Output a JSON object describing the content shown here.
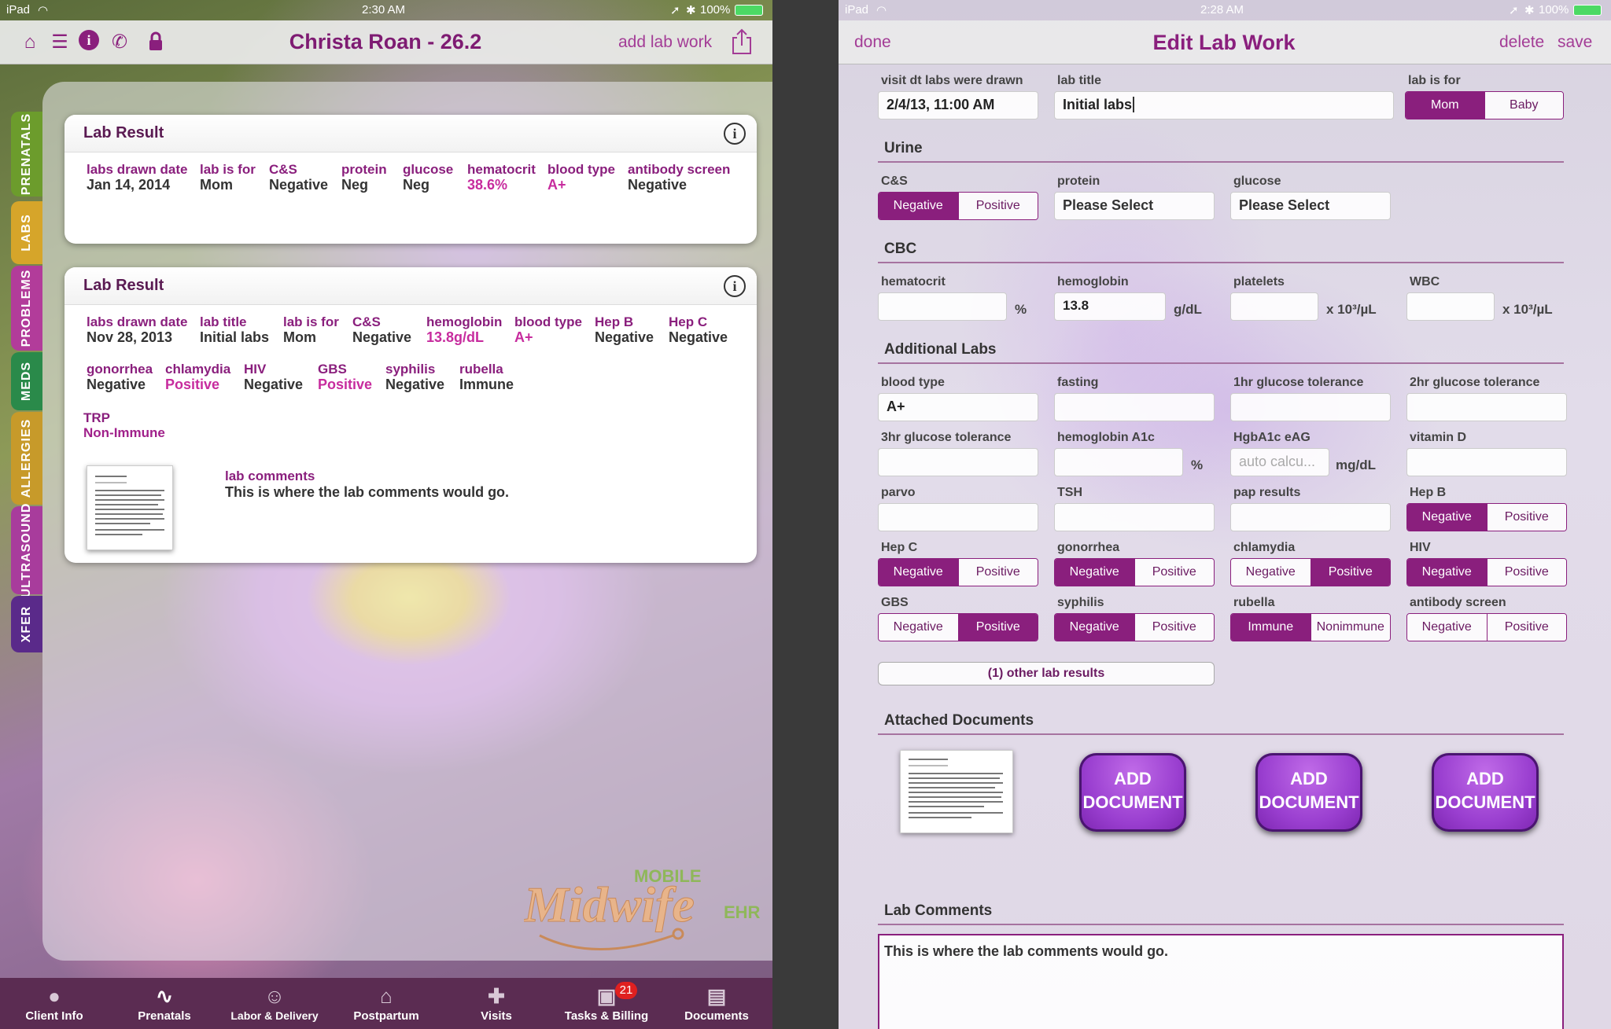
{
  "left": {
    "status": {
      "device": "iPad",
      "time": "2:30 AM",
      "battery": "100%"
    },
    "title": "Christa Roan - 26.2",
    "add_lab": "add lab work",
    "sidetabs": [
      "PRENATALS",
      "LABS",
      "PROBLEMS",
      "MEDS",
      "ALLERGIES",
      "ULTRASOUND",
      "XFER"
    ],
    "card1": {
      "title": "Lab Result",
      "fields": [
        {
          "label": "labs drawn date",
          "value": "Jan 14, 2014"
        },
        {
          "label": "lab is for",
          "value": "Mom"
        },
        {
          "label": "C&S",
          "value": "Negative"
        },
        {
          "label": "protein",
          "value": "Neg"
        },
        {
          "label": "glucose",
          "value": "Neg"
        },
        {
          "label": "hematocrit",
          "value": "38.6%"
        },
        {
          "label": "blood type",
          "value": "A+"
        },
        {
          "label": "antibody screen",
          "value": "Negative"
        }
      ]
    },
    "card2": {
      "title": "Lab Result",
      "row1": [
        {
          "label": "labs drawn date",
          "value": "Nov 28, 2013"
        },
        {
          "label": "lab title",
          "value": "Initial labs"
        },
        {
          "label": "lab is for",
          "value": "Mom"
        },
        {
          "label": "C&S",
          "value": "Negative"
        },
        {
          "label": "hemoglobin",
          "value": "13.8g/dL"
        },
        {
          "label": "blood type",
          "value": "A+"
        },
        {
          "label": "Hep B",
          "value": "Negative"
        },
        {
          "label": "Hep C",
          "value": "Negative"
        }
      ],
      "row2": [
        {
          "label": "gonorrhea",
          "value": "Negative"
        },
        {
          "label": "chlamydia",
          "value": "Positive"
        },
        {
          "label": "HIV",
          "value": "Negative"
        },
        {
          "label": "GBS",
          "value": "Positive"
        },
        {
          "label": "syphilis",
          "value": "Negative"
        },
        {
          "label": "rubella",
          "value": "Immune"
        }
      ],
      "trp": {
        "label": "TRP",
        "value": "Non-Immune"
      },
      "comments_label": "lab comments",
      "comments": "This is where the lab comments would go."
    },
    "bottom_tabs": [
      "Client Info",
      "Prenatals",
      "Labor & Delivery",
      "Postpartum",
      "Visits",
      "Tasks & Billing",
      "Documents"
    ],
    "badge": "21",
    "logo": {
      "mobile": "MOBILE",
      "brand": "Midwife",
      "ehr": "EHR"
    }
  },
  "right": {
    "status": {
      "device": "iPad",
      "time": "2:28 AM",
      "battery": "100%"
    },
    "title": "Edit Lab Work",
    "done": "done",
    "delete": "delete",
    "save": "save",
    "visit_label": "visit dt labs were drawn",
    "visit_value": "2/4/13, 11:00 AM",
    "lab_title_label": "lab title",
    "lab_title_value": "Initial labs",
    "lab_for_label": "lab is for",
    "lab_for_options": [
      "Mom",
      "Baby"
    ],
    "urine": {
      "title": "Urine",
      "cs_label": "C&S",
      "protein_label": "protein",
      "protein_value": "Please Select",
      "glucose_label": "glucose",
      "glucose_value": "Please Select"
    },
    "cbc": {
      "title": "CBC",
      "hematocrit_label": "hematocrit",
      "hematocrit_unit": "%",
      "hemoglobin_label": "hemoglobin",
      "hemoglobin_value": "13.8",
      "hemoglobin_unit": "g/dL",
      "platelets_label": "platelets",
      "platelets_unit": "x 10³/µL",
      "wbc_label": "WBC",
      "wbc_unit": "x 10³/µL"
    },
    "additional": {
      "title": "Additional Labs",
      "blood_type_label": "blood type",
      "blood_type_value": "A+",
      "fasting_label": "fasting",
      "gt1_label": "1hr glucose tolerance",
      "gt2_label": "2hr glucose tolerance",
      "gt3_label": "3hr glucose tolerance",
      "a1c_label": "hemoglobin A1c",
      "a1c_unit": "%",
      "eag_label": "HgbA1c eAG",
      "eag_placeholder": "auto calcu...",
      "eag_unit": "mg/dL",
      "vitd_label": "vitamin D",
      "parvo_label": "parvo",
      "tsh_label": "TSH",
      "pap_label": "pap results",
      "hepb_label": "Hep B",
      "hepc_label": "Hep C",
      "gonorrhea_label": "gonorrhea",
      "chlamydia_label": "chlamydia",
      "hiv_label": "HIV",
      "gbs_label": "GBS",
      "syphilis_label": "syphilis",
      "rubella_label": "rubella",
      "antibody_label": "antibody screen",
      "neg": "Negative",
      "pos": "Positive",
      "immune": "Immune",
      "nonimmune": "Nonimmune",
      "other_results": "(1) other lab results"
    },
    "attached_title": "Attached Documents",
    "add_document": "Add Document",
    "comments_title": "Lab Comments",
    "comments_value": "This is where the lab comments would go."
  }
}
